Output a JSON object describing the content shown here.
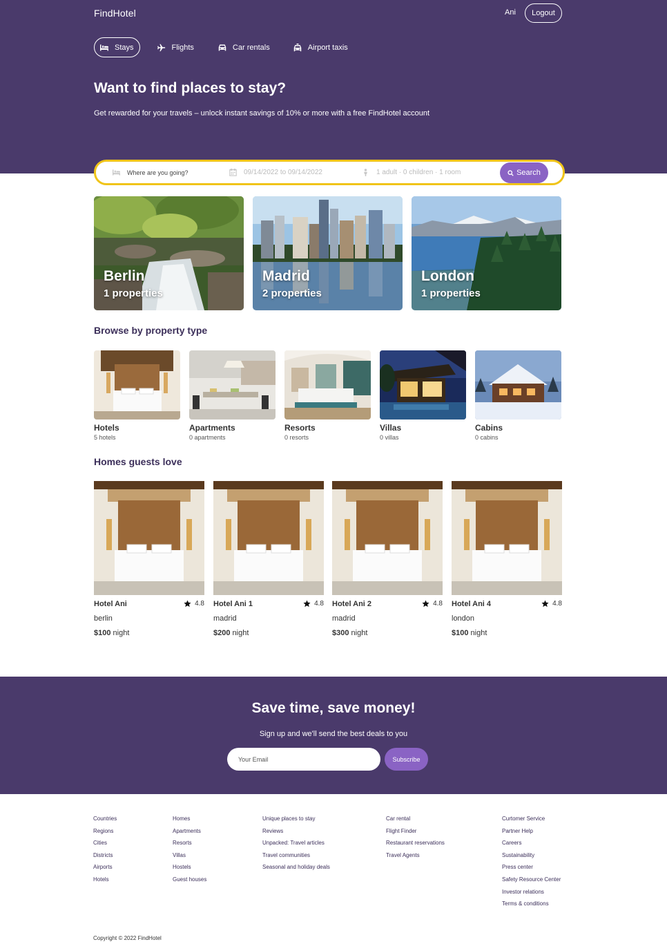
{
  "header": {
    "logo": "FindHotel",
    "user_name": "Ani",
    "logout_label": "Logout",
    "nav": [
      {
        "label": "Stays",
        "icon": "bed-icon",
        "active": true
      },
      {
        "label": "Flights",
        "icon": "plane-icon",
        "active": false
      },
      {
        "label": "Car rentals",
        "icon": "car-icon",
        "active": false
      },
      {
        "label": "Airport taxis",
        "icon": "taxi-icon",
        "active": false
      }
    ],
    "title": "Want to find places to stay?",
    "subtitle": "Get rewarded for your travels – unlock instant savings of 10% or more with a free FindHotel account"
  },
  "search": {
    "destination_placeholder": "Where are you going?",
    "dates": "09/14/2022 to 09/14/2022",
    "guests": "1 adult · 0 children · 1 room",
    "button_label": "Search"
  },
  "cities": [
    {
      "name": "Berlin",
      "properties": "1 properties"
    },
    {
      "name": "Madrid",
      "properties": "2 properties"
    },
    {
      "name": "London",
      "properties": "1 properties"
    }
  ],
  "property_types": {
    "title": "Browse by property type",
    "items": [
      {
        "name": "Hotels",
        "count": "5 hotels"
      },
      {
        "name": "Apartments",
        "count": "0 apartments"
      },
      {
        "name": "Resorts",
        "count": "0 resorts"
      },
      {
        "name": "Villas",
        "count": "0 villas"
      },
      {
        "name": "Cabins",
        "count": "0 cabins"
      }
    ]
  },
  "homes": {
    "title": "Homes guests love",
    "items": [
      {
        "name": "Hotel Ani",
        "rating": "4.8",
        "city": "berlin",
        "price": "$100",
        "unit": " night"
      },
      {
        "name": "Hotel Ani 1",
        "rating": "4.8",
        "city": "madrid",
        "price": "$200",
        "unit": " night"
      },
      {
        "name": "Hotel Ani 2",
        "rating": "4.8",
        "city": "madrid",
        "price": "$300",
        "unit": " night"
      },
      {
        "name": "Hotel Ani 4",
        "rating": "4.8",
        "city": "london",
        "price": "$100",
        "unit": " night"
      }
    ]
  },
  "newsletter": {
    "title": "Save time, save money!",
    "subtitle": "Sign up and we'll send the best deals to you",
    "email_placeholder": "Your Email",
    "button_label": "Subscribe"
  },
  "footer": {
    "columns": [
      [
        "Countries",
        "Regions",
        "Cities",
        "Districts",
        "Airports",
        "Hotels"
      ],
      [
        "Homes",
        "Apartments",
        "Resorts",
        "Villas",
        "Hostels",
        "Guest houses"
      ],
      [
        "Unique places to stay",
        "Reviews",
        "Unpacked: Travel articles",
        "Travel communities",
        "Seasonal and holiday deals"
      ],
      [
        "Car rental",
        "Flight Finder",
        "Restaurant reservations",
        "Travel Agents"
      ],
      [
        "Curtomer Service",
        "Partner Help",
        "Careers",
        "Sustainability",
        "Press center",
        "Safety Resource Center",
        "Investor relations",
        "Terms & conditions"
      ]
    ],
    "copyright": "Copyright © 2022 FindHotel"
  },
  "colors": {
    "brand_purple": "#4a3a6b",
    "accent_purple": "#8a63c4",
    "search_border": "#f0c419"
  }
}
